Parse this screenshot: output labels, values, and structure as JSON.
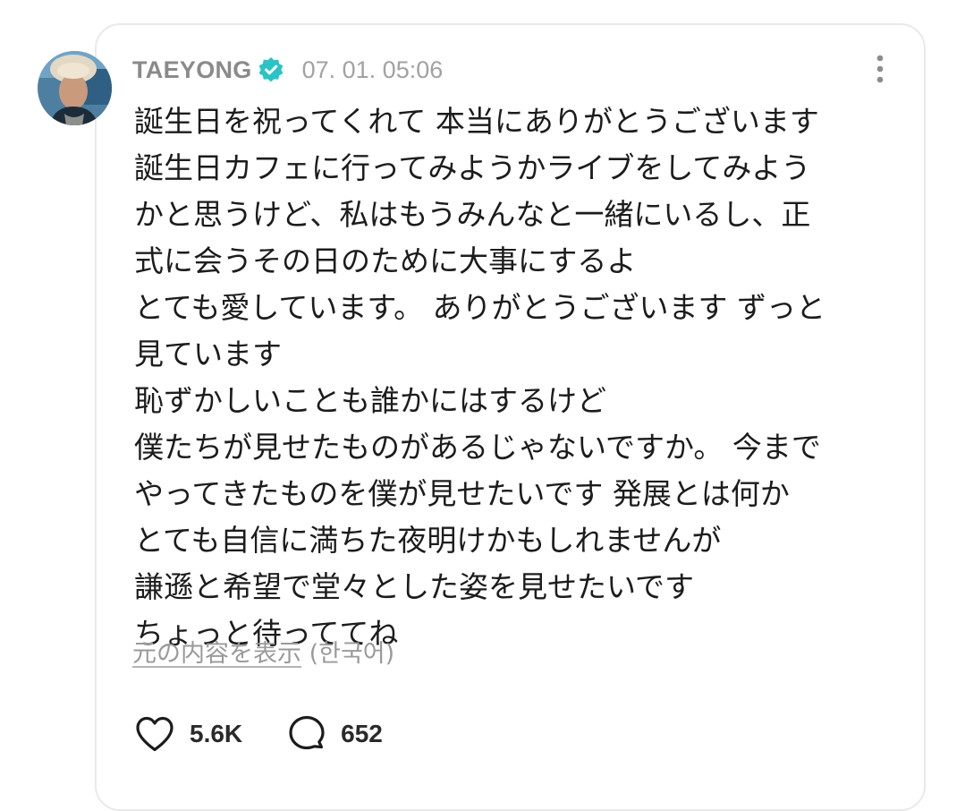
{
  "post": {
    "author": {
      "name": "TAEYONG",
      "verified": true,
      "badge_color": "#2bc3c6",
      "avatar_icon": "profile-photo"
    },
    "timestamp": "07. 01. 05:06",
    "menu_icon": "vertical-dots-icon",
    "body_lines": [
      "誕生日を祝ってくれて 本当にありがとうございます",
      "誕生日カフェに行ってみようかライブをしてみよう",
      "かと思うけど、私はもうみんなと一緒にいるし、正",
      "式に会うその日のために大事にするよ",
      "とても愛しています。 ありがとうございます ずっと",
      "見ています",
      "恥ずかしいことも誰かにはするけど",
      "僕たちが見せたものがあるじゃないですか。 今まで",
      "やってきたものを僕が見せたいです 発展とは何か",
      "とても自信に満ちた夜明けかもしれませんが",
      "謙遜と希望で堂々とした姿を見せたいです",
      "ちょっと待っててね"
    ],
    "translation": {
      "link_label": "元の内容を表示",
      "language": "(한국어)"
    },
    "actions": {
      "like_icon": "heart-icon",
      "like_count": "5.6K",
      "comment_icon": "comment-bubble-icon",
      "comment_count": "652"
    }
  }
}
